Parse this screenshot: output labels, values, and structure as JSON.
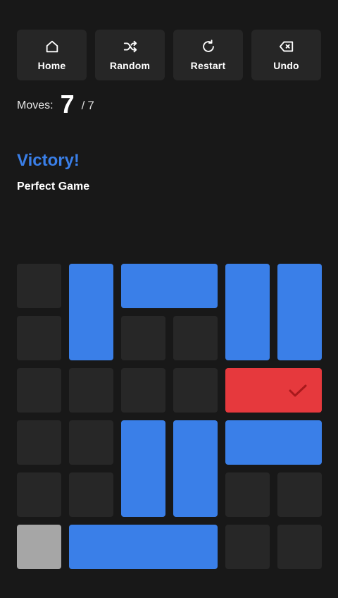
{
  "toolbar": {
    "home": {
      "label": "Home",
      "icon": "home-icon"
    },
    "random": {
      "label": "Random",
      "icon": "shuffle-icon"
    },
    "restart": {
      "label": "Restart",
      "icon": "restart-icon"
    },
    "undo": {
      "label": "Undo",
      "icon": "undo-icon"
    }
  },
  "moves": {
    "label": "Moves:",
    "count": "7",
    "separator": "/",
    "target": "7"
  },
  "status": {
    "title": "Victory!",
    "subtitle": "Perfect Game"
  },
  "board": {
    "columns": 6,
    "rows": 6,
    "blocks": [
      {
        "color": "blue",
        "col": 1,
        "row": 0,
        "width": 1,
        "height": 2
      },
      {
        "color": "blue",
        "col": 2,
        "row": 0,
        "width": 2,
        "height": 1
      },
      {
        "color": "blue",
        "col": 4,
        "row": 0,
        "width": 1,
        "height": 2
      },
      {
        "color": "blue",
        "col": 5,
        "row": 0,
        "width": 1,
        "height": 2
      },
      {
        "color": "red",
        "col": 4,
        "row": 2,
        "width": 2,
        "height": 1,
        "goal_reached": true
      },
      {
        "color": "blue",
        "col": 2,
        "row": 3,
        "width": 1,
        "height": 2
      },
      {
        "color": "blue",
        "col": 3,
        "row": 3,
        "width": 1,
        "height": 2
      },
      {
        "color": "blue",
        "col": 4,
        "row": 3,
        "width": 2,
        "height": 1
      },
      {
        "color": "grey",
        "col": 0,
        "row": 5,
        "width": 1,
        "height": 1
      },
      {
        "color": "blue",
        "col": 1,
        "row": 5,
        "width": 3,
        "height": 1
      }
    ]
  },
  "colors": {
    "background": "#181818",
    "button": "#262626",
    "cell": "#272727",
    "blue_block": "#3a7fe8",
    "red_block": "#e6393d",
    "grey_block": "#a6a6a6",
    "accent": "#3a7fe8"
  }
}
